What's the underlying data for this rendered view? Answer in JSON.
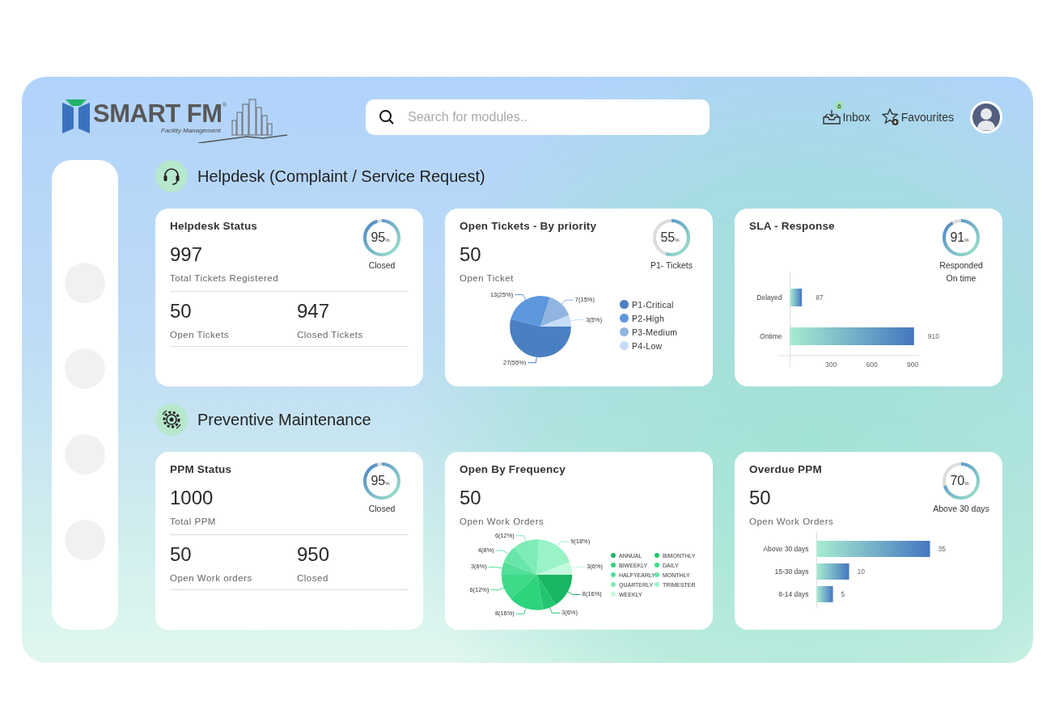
{
  "header": {
    "logo": {
      "name": "SMART FM",
      "registered": "®",
      "tagline": "Facility Management"
    },
    "search": {
      "placeholder": "Search for modules.."
    },
    "links": [
      {
        "kind": "inbox",
        "label": "Inbox",
        "badge": "6"
      },
      {
        "kind": "favourites",
        "label": "Favourites"
      }
    ]
  },
  "sections": [
    {
      "title": "Helpdesk (Complaint / Service Request)",
      "cards": [
        {
          "kind": "status",
          "title": "Helpdesk Status",
          "value": "997",
          "caption": "Total Tickets Registered",
          "gauge": {
            "value": "95",
            "unit": "%",
            "level": 0.95,
            "label": "Closed"
          },
          "stats": [
            {
              "value": "50",
              "label": "Open Tickets"
            },
            {
              "value": "947",
              "label": "Closed Tickets"
            }
          ]
        },
        {
          "kind": "chart",
          "title": "Open Tickets - By priority",
          "value": "50",
          "caption": "Open Ticket",
          "gauge": {
            "value": "55",
            "unit": "%",
            "level": 0.55,
            "label": "P1- Tickets"
          },
          "chart_data": {
            "type": "pie",
            "legend": true,
            "categories": [
              "P1-Critical",
              "P2-High",
              "P3-Medium",
              "P4-Low"
            ],
            "values": [
              27,
              13,
              7,
              3
            ],
            "colors": [
              "#4a7fc1",
              "#5d97dc",
              "#90b5e0",
              "#c6ddf8"
            ],
            "value_labels": [
              "27(55%)",
              "13(25%)",
              "7(15%)",
              "3(5%)"
            ]
          }
        },
        {
          "kind": "chart",
          "title": "SLA - Response",
          "gauge": {
            "value": "91",
            "unit": "%",
            "level": 0.91,
            "label": "Responded\nOn time"
          },
          "chart_data": {
            "type": "bar",
            "orientation": "horizontal",
            "categories": [
              "Delayed",
              "Ontime"
            ],
            "values": [
              87,
              910
            ],
            "xlim": [
              0,
              950
            ],
            "xticks": [
              300,
              600,
              900
            ],
            "data_labels": true
          }
        }
      ]
    },
    {
      "title": "Preventive Maintenance",
      "cards": [
        {
          "kind": "status",
          "title": "PPM Status",
          "value": "1000",
          "caption": "Total PPM",
          "gauge": {
            "value": "95",
            "unit": "%",
            "level": 0.95,
            "label": "Closed"
          },
          "stats": [
            {
              "value": "50",
              "label": "Open Work orders"
            },
            {
              "value": "950",
              "label": "Closed"
            }
          ]
        },
        {
          "kind": "chart",
          "title": "Open By Frequency",
          "value": "50",
          "caption": "Open Work Orders",
          "chart_data": {
            "type": "pie",
            "legend": true,
            "categories": [
              "ANNUAL",
              "BIMONTHLY",
              "BIWEEKLY",
              "DAILY",
              "HALFYEARLY",
              "MONTHLY",
              "QUARTERLY",
              "TRIMESTER",
              "WEEKLY"
            ],
            "values": [
              8,
              3,
              8,
              6,
              3,
              4,
              6,
              9,
              3
            ],
            "colors": [
              "#19b663",
              "#22c56e",
              "#2cd47c",
              "#3ddb89",
              "#52e09b",
              "#68e6a9",
              "#7eecb7",
              "#99f3c7",
              "#c3fadd"
            ],
            "value_labels": [
              "8(16%)",
              "3(6%)",
              "8(16%)",
              "6(12%)",
              "3(6%)",
              "4(8%)",
              "6(12%)",
              "9(18%)",
              "3(6%)"
            ]
          }
        },
        {
          "kind": "chart",
          "title": "Overdue PPM",
          "value": "50",
          "caption": "Open Work Orders",
          "gauge": {
            "value": "70",
            "unit": "%",
            "level": 0.7,
            "label": "Above 30 days"
          },
          "chart_data": {
            "type": "bar",
            "orientation": "horizontal",
            "categories": [
              "Above 30 days",
              "15-30 days",
              "8-14 days"
            ],
            "values": [
              35,
              10,
              5
            ],
            "data_labels": true
          }
        }
      ]
    }
  ]
}
